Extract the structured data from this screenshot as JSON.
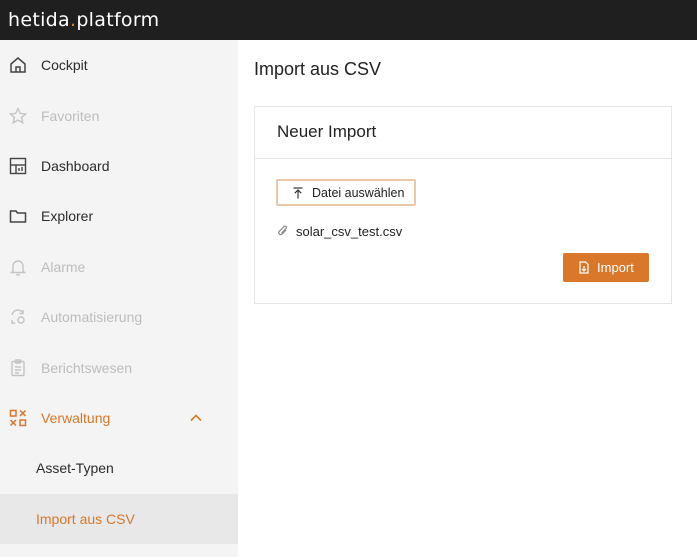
{
  "app": {
    "logo_text_a": "hetida",
    "logo_dot": ".",
    "logo_text_b": "platform",
    "accent_color": "#d9772b"
  },
  "sidebar": {
    "items": [
      {
        "label": "Cockpit",
        "icon": "home-icon",
        "state": "enabled"
      },
      {
        "label": "Favoriten",
        "icon": "star-icon",
        "state": "disabled"
      },
      {
        "label": "Dashboard",
        "icon": "dashboard-icon",
        "state": "enabled"
      },
      {
        "label": "Explorer",
        "icon": "folder-icon",
        "state": "enabled"
      },
      {
        "label": "Alarme",
        "icon": "bell-icon",
        "state": "disabled"
      },
      {
        "label": "Automatisierung",
        "icon": "automation-icon",
        "state": "disabled"
      },
      {
        "label": "Berichtswesen",
        "icon": "report-icon",
        "state": "disabled"
      },
      {
        "label": "Verwaltung",
        "icon": "admin-icon",
        "state": "expanded",
        "chevron": "chevron-up-icon"
      }
    ],
    "subitems": [
      {
        "label": "Asset-Typen",
        "selected": false
      },
      {
        "label": "Import aus CSV",
        "selected": true
      }
    ]
  },
  "main": {
    "page_title": "Import aus CSV",
    "card": {
      "title": "Neuer Import",
      "choose_file_label": "Datei auswählen",
      "choose_file_icon": "upload-icon",
      "file_name": "solar_csv_test.csv",
      "file_icon": "paperclip-icon",
      "import_label": "Import",
      "import_icon": "file-import-icon"
    }
  }
}
